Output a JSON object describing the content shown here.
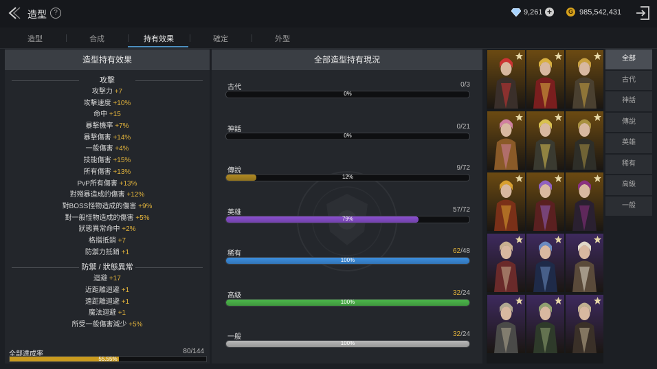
{
  "header": {
    "title": "造型",
    "help_label": "?",
    "diamond_count": "9,261",
    "gold_count": "985,542,431"
  },
  "tabs": [
    {
      "label": "造型"
    },
    {
      "label": "合成"
    },
    {
      "label": "持有效果"
    },
    {
      "label": "確定"
    },
    {
      "label": "外型"
    }
  ],
  "left_panel": {
    "title": "造型持有效果",
    "sections": [
      {
        "title": "攻擊",
        "stats": [
          {
            "name": "攻擊力",
            "value": "+7"
          },
          {
            "name": "攻擊速度",
            "value": "+10%"
          },
          {
            "name": "命中",
            "value": "+15"
          },
          {
            "name": "暴擊機率",
            "value": "+7%"
          },
          {
            "name": "暴擊傷害",
            "value": "+14%"
          },
          {
            "name": "一般傷害",
            "value": "+4%"
          },
          {
            "name": "技能傷害",
            "value": "+15%"
          },
          {
            "name": "所有傷害",
            "value": "+13%"
          },
          {
            "name": "PvP所有傷害",
            "value": "+13%"
          },
          {
            "name": "對殘暴造成的傷害",
            "value": "+12%"
          },
          {
            "name": "對BOSS怪物造成的傷害",
            "value": "+9%"
          },
          {
            "name": "對一般怪物造成的傷害",
            "value": "+5%"
          },
          {
            "name": "狀態異常命中",
            "value": "+2%"
          },
          {
            "name": "格擋抵銷",
            "value": "+7"
          },
          {
            "name": "防禦力抵銷",
            "value": "+1"
          }
        ]
      },
      {
        "title": "防禦 / 狀態異常",
        "stats": [
          {
            "name": "迴避",
            "value": "+17"
          },
          {
            "name": "近距離迴避",
            "value": "+1"
          },
          {
            "name": "遠距離迴避",
            "value": "+1"
          },
          {
            "name": "魔法迴避",
            "value": "+1"
          },
          {
            "name": "所受一般傷害減少",
            "value": "+5%"
          }
        ]
      }
    ],
    "achievement": {
      "label": "全部達成率",
      "count": "80/144",
      "percent_text": "55.55%",
      "ratio": 0.5555
    }
  },
  "mid_panel": {
    "title": "全部造型持有現況",
    "rarities": [
      {
        "name": "古代",
        "have": "0",
        "total": "/3",
        "percent_text": "0%",
        "ratio": 0,
        "color": "#9a9a9a",
        "over": false
      },
      {
        "name": "神話",
        "have": "0",
        "total": "/21",
        "percent_text": "0%",
        "ratio": 0,
        "color": "#9a9a9a",
        "over": false
      },
      {
        "name": "傳說",
        "have": "9",
        "total": "/72",
        "percent_text": "12%",
        "ratio": 0.125,
        "color": "#b08a22",
        "over": false
      },
      {
        "name": "英雄",
        "have": "57",
        "total": "/72",
        "percent_text": "79%",
        "ratio": 0.79,
        "color": "#8a4fd0",
        "over": false
      },
      {
        "name": "稀有",
        "have": "62",
        "total": "/48",
        "percent_text": "100%",
        "ratio": 1,
        "color": "#3c8ee0",
        "over": true
      },
      {
        "name": "高級",
        "have": "32",
        "total": "/24",
        "percent_text": "100%",
        "ratio": 1,
        "color": "#4cb84a",
        "over": true
      },
      {
        "name": "一般",
        "have": "32",
        "total": "/24",
        "percent_text": "100%",
        "ratio": 1,
        "color": "#b8b8b8",
        "over": true
      }
    ]
  },
  "filters": [
    {
      "label": "全部"
    },
    {
      "label": "古代"
    },
    {
      "label": "神話"
    },
    {
      "label": "傳說"
    },
    {
      "label": "英雄"
    },
    {
      "label": "稀有"
    },
    {
      "label": "高級"
    },
    {
      "label": "一般"
    }
  ],
  "gallery": {
    "cards": [
      {
        "rarity": "legendary",
        "bg": "#6b4a12",
        "outfit": "#3a2f2a",
        "accent": "#c33",
        "emblem": "crown-icon"
      },
      {
        "rarity": "legendary",
        "bg": "#6b4a12",
        "outfit": "#7a1e1e",
        "accent": "#d8b040",
        "emblem": "crown-icon"
      },
      {
        "rarity": "legendary",
        "bg": "#6b4a12",
        "outfit": "#4a4030",
        "accent": "#c8a040",
        "emblem": "crown-icon"
      },
      {
        "rarity": "legendary",
        "bg": "#6b4a12",
        "outfit": "#8a5a28",
        "accent": "#d080a0",
        "emblem": "crown-icon"
      },
      {
        "rarity": "legendary",
        "bg": "#6b4a12",
        "outfit": "#3a3a30",
        "accent": "#d8c050",
        "emblem": "crown-icon"
      },
      {
        "rarity": "legendary",
        "bg": "#6b4a12",
        "outfit": "#2e2e28",
        "accent": "#a89040",
        "emblem": "crown-icon"
      },
      {
        "rarity": "legendary",
        "bg": "#6b4a12",
        "outfit": "#7a3018",
        "accent": "#d8a030",
        "emblem": "crown-icon"
      },
      {
        "rarity": "legendary",
        "bg": "#6b4a12",
        "outfit": "#5a2020",
        "accent": "#9060c0",
        "emblem": "crown-icon"
      },
      {
        "rarity": "legendary",
        "bg": "#6b4a12",
        "outfit": "#2a2030",
        "accent": "#8a3080",
        "emblem": "crown-icon"
      },
      {
        "rarity": "hero",
        "bg": "#3e2a5e",
        "outfit": "#6a2a2a",
        "accent": "#c8b090",
        "emblem": "wing-icon"
      },
      {
        "rarity": "hero",
        "bg": "#3e2a5e",
        "outfit": "#1e2a48",
        "accent": "#6a8ac0",
        "emblem": "wing-icon"
      },
      {
        "rarity": "hero",
        "bg": "#3e2a5e",
        "outfit": "#5a4a3a",
        "accent": "#e0d8c8",
        "emblem": "wing-icon"
      },
      {
        "rarity": "hero",
        "bg": "#3e2a5e",
        "outfit": "#4a4a48",
        "accent": "#b0a890",
        "emblem": "wing-icon"
      },
      {
        "rarity": "hero",
        "bg": "#3e2a5e",
        "outfit": "#2e3a2a",
        "accent": "#90a070",
        "emblem": "wing-icon"
      },
      {
        "rarity": "hero",
        "bg": "#3e2a5e",
        "outfit": "#3a3028",
        "accent": "#c0b090",
        "emblem": "wing-icon"
      }
    ]
  }
}
